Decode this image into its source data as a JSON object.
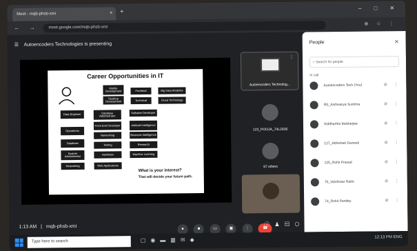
{
  "browser": {
    "tab_title": "Meet - mqb-phsb-xmi",
    "tab_close": "×",
    "new_tab": "+",
    "address": "meet.google.com/mqb-phsb-xmi",
    "nav": "← → C",
    "extensions": "⊕ ☆ ⋮",
    "window_buttons": "– □ ✕"
  },
  "meet": {
    "presenting_banner": "Autoencoders Technologies is presenting",
    "time": "1:13 AM",
    "meeting_code": "mqb-phsb-xmi",
    "tiles": [
      {
        "label": "Autoencoders Technolog..."
      },
      {
        "label": "123_POOJA_74L2936"
      },
      {
        "label": "67 others"
      },
      {
        "label": ""
      }
    ]
  },
  "slide": {
    "title": "Career Opportunities in IT",
    "boxes": [
      "Mobile Development",
      "Frontend",
      "Big Data Analytics",
      "Desktop Development",
      "Technical",
      "Cloud Technology",
      "Data Engineer",
      "Database Administrator",
      "Software Developer",
      "Front End Developer",
      "Artificial Intelligence",
      "Operations",
      "Networking",
      "Business Intelligence",
      "Database",
      "Testing",
      "Research",
      "System Administrator",
      "Hardware",
      "Machine Learning",
      "Networking",
      "Web Applications"
    ],
    "question": "What is your interest?",
    "answer": "That will decide your future path."
  },
  "people_panel": {
    "title": "People",
    "close": "✕",
    "search_placeholder": "Search for people",
    "section": "In call",
    "participants": [
      "Autoencoders Tech (You)",
      "RE_Aishwarya Sushma",
      "Siddhartha Mukherjee",
      "127_Abhishek Dwivedi",
      "125_Rohit Prasad",
      "70_Vaishnavi Rathi",
      "74_Rohit Pandey"
    ]
  },
  "taskbar": {
    "search": "Type here to search",
    "tray": "12:13 PM  ENG"
  }
}
